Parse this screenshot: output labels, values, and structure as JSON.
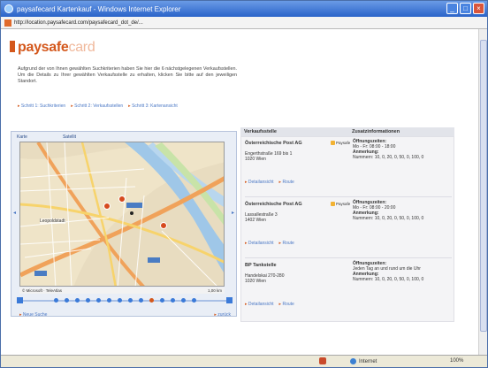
{
  "window": {
    "title": "paysafecard Kartenkauf - Windows Internet Explorer",
    "controls": {
      "minimize": "_",
      "maximize": "□",
      "close": "×"
    }
  },
  "address": {
    "url": "http://location.paysafecard.com/paysafecard_dot_de/..."
  },
  "page": {
    "logo_main": "paysafe",
    "logo_suffix": "card",
    "intro": "Aufgrund der von Ihnen gewählten Suchkriterien haben Sie hier die 6 nächstgelegenen Verkaufsstellen. Um die Details zu Ihrer gewählten Verkaufsstelle zu erhalten, klicken Sie bitte auf den jeweiligen Standort.",
    "breadcrumbs": [
      "Schritt 1: Suchkriterien",
      "Schritt 2: Verkaufsstellen",
      "Schritt 3: Kartenansicht"
    ]
  },
  "map": {
    "tabs": [
      "Karte",
      "Satellit"
    ],
    "footer_left": "© Microsoft · TeleAtlas",
    "footer_right": "1,00 km",
    "district_label": "Leopoldstadt",
    "arrow_left": "◂",
    "arrow_right": "▸"
  },
  "pager": {
    "page_count": 14,
    "active_page": 10
  },
  "nav": {
    "back": "Neue Suche",
    "next": "zurück"
  },
  "results": {
    "col1": "Verkaufsstelle",
    "col2": "Zusatzinformationen",
    "badge_label": "Paysafe",
    "items": [
      {
        "name": "Österreichische Post AG",
        "street": "Engerthstraße 169 bis 1",
        "city": "1020 Wien",
        "hours_label": "Öffnungszeiten:",
        "hours": "Mo - Fr: 08:00 - 18:00",
        "note_label": "Anmerkung:",
        "note": "Nummern: 10, 0, 20, 0, 50, 0, 100, 0",
        "links": [
          "Detailansicht",
          "Route"
        ]
      },
      {
        "name": "Österreichische Post AG",
        "street": "Lassallestraße 3",
        "city": "1402 Wien",
        "hours_label": "Öffnungszeiten:",
        "hours": "Mo - Fr: 08:00 - 20:00",
        "note_label": "Anmerkung:",
        "note": "Nummern: 10, 0, 20, 0, 50, 0, 100, 0",
        "links": [
          "Detailansicht",
          "Route"
        ]
      },
      {
        "name": "BP Tankstelle",
        "street": "Handelskai 270-280",
        "city": "1020 Wien",
        "hours_label": "Öffnungszeiten:",
        "hours": "Jeden Tag an und rund um die Uhr",
        "note_label": "Anmerkung:",
        "note": "Nummern: 10, 0, 20, 0, 50, 0, 100, 0",
        "links": [
          "Detailansicht",
          "Route"
        ]
      }
    ]
  },
  "status": {
    "zone": "Internet",
    "zoom": "100%"
  },
  "colors": {
    "brand": "#d4581c",
    "link": "#4b78c5",
    "water": "#9fc7e8",
    "road_major": "#f0a25a"
  }
}
